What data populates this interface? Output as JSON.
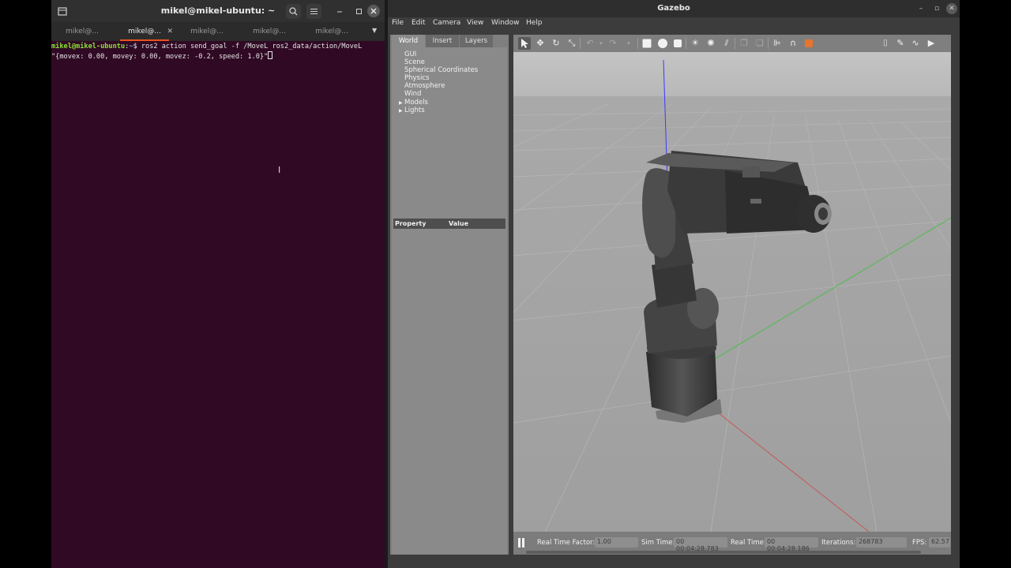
{
  "terminal": {
    "title": "mikel@mikel-ubuntu: ~",
    "tabs": [
      {
        "label": "mikel@..."
      },
      {
        "label": "mikel@..."
      },
      {
        "label": "mikel@..."
      },
      {
        "label": "mikel@..."
      },
      {
        "label": "mikel@..."
      }
    ],
    "prompt_user": "mikel@mikel-ubuntu",
    "prompt_sep": ":",
    "prompt_path": "~",
    "prompt_symbol": "$ ",
    "command_line1": "ros2 action send_goal -f /MoveL ros2_data/action/MoveL",
    "command_line2": "\"{movex: 0.00, movey: 0.00, movez: -0.2, speed: 1.0}\"",
    "icons": [
      "new-tab-icon",
      "search-icon",
      "hamburger-menu-icon",
      "minimize-icon",
      "maximize-icon",
      "close-icon"
    ]
  },
  "gazebo": {
    "title": "Gazebo",
    "menu": [
      "File",
      "Edit",
      "Camera",
      "View",
      "Window",
      "Help"
    ],
    "left_tabs": [
      "World",
      "Insert",
      "Layers"
    ],
    "tree": [
      "GUI",
      "Scene",
      "Spherical Coordinates",
      "Physics",
      "Atmosphere",
      "Wind",
      "Models",
      "Lights"
    ],
    "property_header": {
      "property": "Property",
      "value": "Value"
    },
    "status": {
      "real_time_factor_label": "Real Time Factor:",
      "real_time_factor": "1.00",
      "sim_time_label": "Sim Time:",
      "sim_time": "00 00:04:28.783",
      "real_time_label": "Real Time:",
      "real_time": "00 00:04:28.186",
      "iterations_label": "Iterations:",
      "iterations": "268783",
      "fps_label": "FPS:",
      "fps": "62.57"
    },
    "colors": {
      "axis_z": "#3a3aff",
      "axis_y": "#36c236",
      "axis_x": "#d23c3c",
      "robot": "#3a3a3a"
    }
  }
}
